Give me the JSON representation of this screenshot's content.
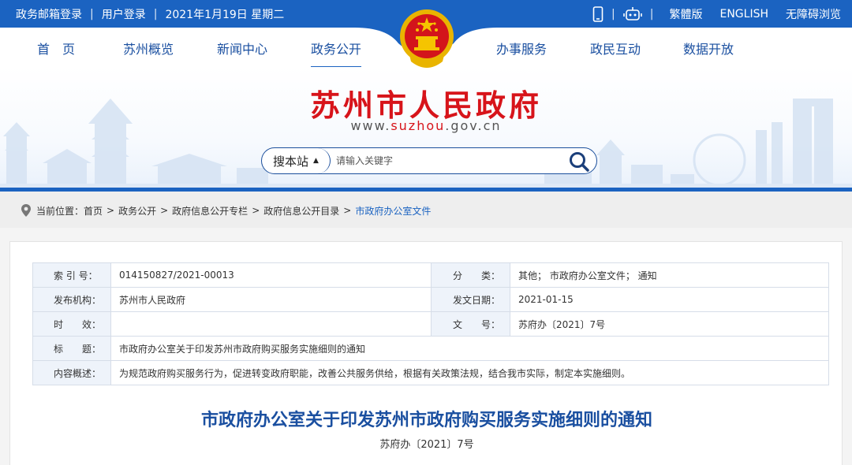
{
  "topbar": {
    "mail_login": "政务邮箱登录",
    "user_login": "用户登录",
    "date": "2021年1月19日 星期二",
    "traditional": "繁體版",
    "english": "ENGLISH",
    "accessible": "无障碍浏览",
    "icons": [
      "mobile-icon",
      "robot-icon"
    ]
  },
  "nav": {
    "items": [
      "首　页",
      "苏州概览",
      "新闻中心",
      "政务公开",
      "办事服务",
      "政民互动",
      "数据开放"
    ],
    "active": "政务公开"
  },
  "banner": {
    "site_title": "苏州市人民政府",
    "url_prefix": "www.",
    "url_highlight": "suzhou",
    "url_suffix": ".gov.cn"
  },
  "search": {
    "scope_label": "搜本站",
    "placeholder": "请输入关键字"
  },
  "breadcrumb": {
    "prefix": "当前位置：",
    "items": [
      "首页",
      "政务公开",
      "政府信息公开专栏",
      "政府信息公开目录"
    ],
    "current": "市政府办公室文件",
    "separator": ">"
  },
  "meta": {
    "index_label": "索 引 号：",
    "index_value": "014150827/2021-00013",
    "category_label": "分　　类：",
    "category_value": "其他； 市政府办公室文件； 通知",
    "publisher_label": "发布机构：",
    "publisher_value": "苏州市人民政府",
    "date_label": "发文日期：",
    "date_value": "2021-01-15",
    "validity_label": "时　　效：",
    "validity_value": "",
    "docno_label": "文　　号：",
    "docno_value": "苏府办〔2021〕7号",
    "title_label": "标　　题：",
    "title_value": "市政府办公室关于印发苏州市政府购买服务实施细则的通知",
    "summary_label": "内容概述：",
    "summary_value": "为规范政府购买服务行为，促进转变政府职能，改善公共服务供给，根据有关政策法规，结合我市实际，制定本实施细则。"
  },
  "document": {
    "title": "市政府办公室关于印发苏州市政府购买服务实施细则的通知",
    "number": "苏府办〔2021〕7号"
  },
  "colors": {
    "brand_blue": "#1b63c1",
    "title_red": "#d7141a"
  }
}
